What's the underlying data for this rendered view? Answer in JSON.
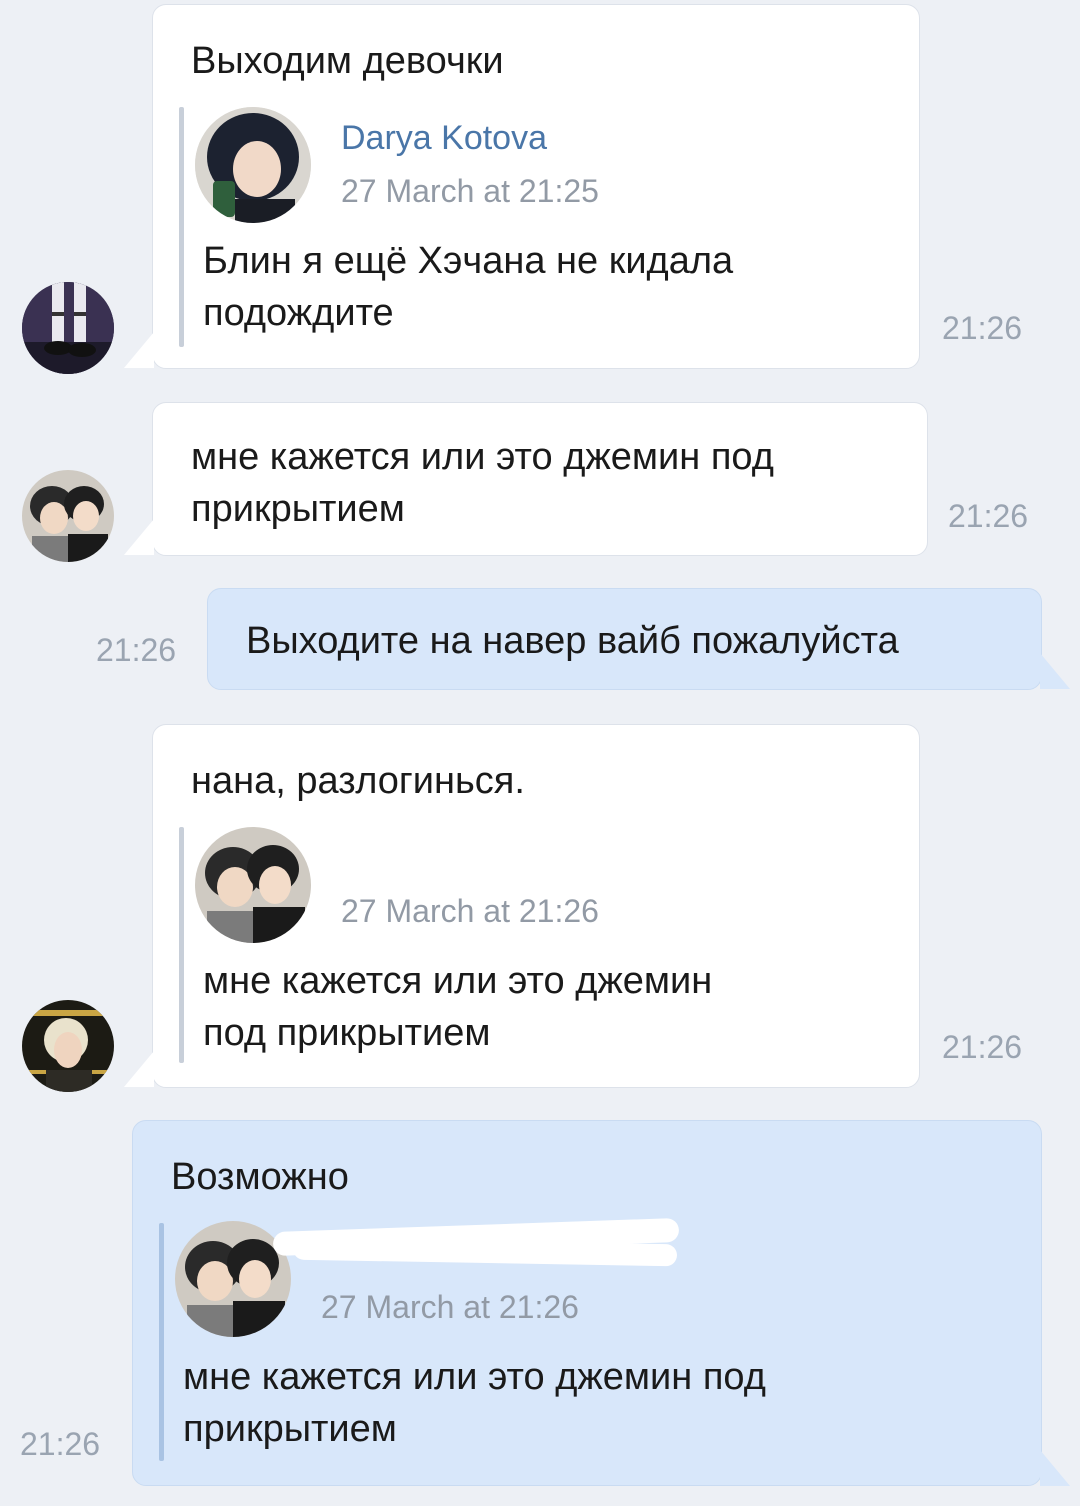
{
  "messages": [
    {
      "text": "Выходим девочки",
      "time": "21:26",
      "quote": {
        "author": "Darya Kotova",
        "date": "27 March at 21:25",
        "text": "Блин я ещё Хэчана не кидала\nподождите"
      }
    },
    {
      "text": "мне кажется или это джемин под\nприкрытием",
      "time": "21:26"
    },
    {
      "text": "Выходите на навер вайб пожалуйста",
      "time": "21:26"
    },
    {
      "text": "нана, разлогинься.",
      "time": "21:26",
      "quote": {
        "date": "27 March at 21:26",
        "text": "мне кажется или это джемин\nпод прикрытием"
      }
    },
    {
      "text": "Возможно",
      "time": "21:26",
      "quote": {
        "date": "27 March at 21:26",
        "text": "мне кажется или это джемин под\nприкрытием"
      }
    }
  ],
  "icons": [
    "avatar-socks",
    "avatar-anime-duo",
    "avatar-blonde"
  ],
  "colors": {
    "background": "#edf0f5",
    "incoming": "#ffffff",
    "outgoing": "#d8e7fa",
    "link": "#4a76a8",
    "time": "#9aa4b1"
  }
}
